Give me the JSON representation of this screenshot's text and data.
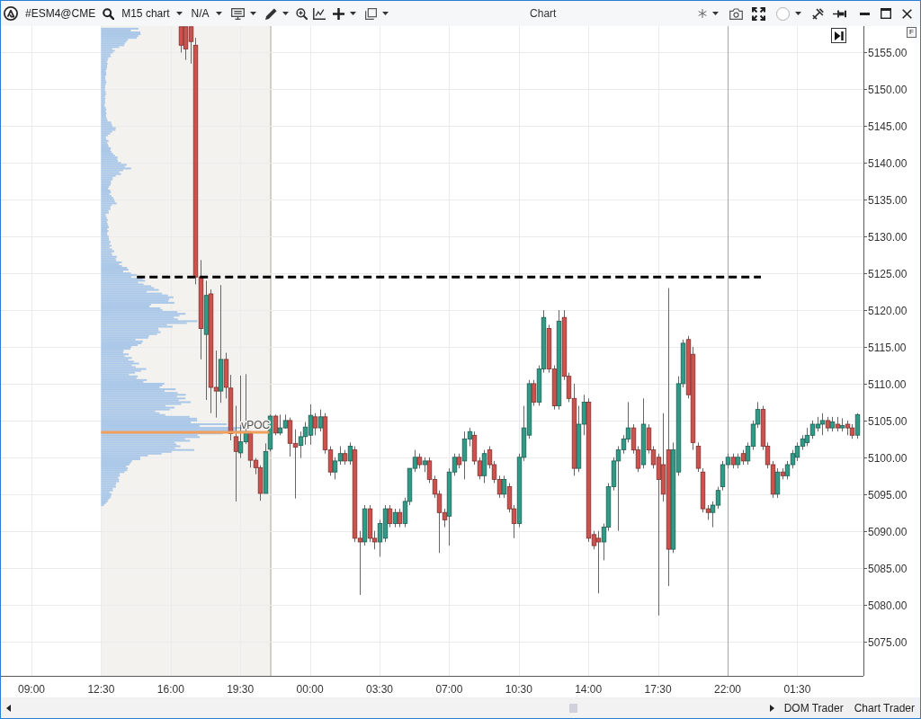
{
  "window": {
    "title": "Chart"
  },
  "toolbar": {
    "instrument": "#ESM4@CME",
    "timeframe": "M15 chart",
    "template": "N/A"
  },
  "chart": {
    "corner_badge": "F",
    "chart_data": {
      "type": "candlestick",
      "grid": true,
      "ylim": [
        5070.3,
        5158.6
      ],
      "yticks": [
        {
          "value": 5155,
          "label": "5155.00"
        },
        {
          "value": 5150,
          "label": "5150.00"
        },
        {
          "value": 5145,
          "label": "5145.00"
        },
        {
          "value": 5140,
          "label": "5140.00"
        },
        {
          "value": 5135,
          "label": "5135.00"
        },
        {
          "value": 5130,
          "label": "5130.00"
        },
        {
          "value": 5125,
          "label": "5125.00"
        },
        {
          "value": 5120,
          "label": "5120.00"
        },
        {
          "value": 5115,
          "label": "5115.00"
        },
        {
          "value": 5110,
          "label": "5110.00"
        },
        {
          "value": 5105,
          "label": "5105.00"
        },
        {
          "value": 5100,
          "label": "5100.00"
        },
        {
          "value": 5095,
          "label": "5095.00"
        },
        {
          "value": 5090,
          "label": "5090.00"
        },
        {
          "value": 5085,
          "label": "5085.00"
        },
        {
          "value": 5080,
          "label": "5080.00"
        },
        {
          "value": 5075,
          "label": "5075.00"
        }
      ],
      "categories": [
        "09:00",
        null,
        null,
        null,
        null,
        null,
        null,
        null,
        null,
        null,
        null,
        null,
        null,
        null,
        "12:30",
        null,
        null,
        null,
        null,
        null,
        null,
        null,
        null,
        null,
        null,
        null,
        null,
        null,
        "16:00",
        null,
        null,
        null,
        null,
        null,
        null,
        null,
        null,
        null,
        null,
        null,
        null,
        null,
        "19:30",
        null,
        null,
        null,
        null,
        null,
        null,
        null,
        null,
        null,
        null,
        null,
        null,
        null,
        "00:00",
        null,
        null,
        null,
        null,
        null,
        null,
        null,
        null,
        null,
        null,
        null,
        null,
        null,
        "03:30",
        null,
        null,
        null,
        null,
        null,
        null,
        null,
        null,
        null,
        null,
        null,
        null,
        null,
        "07:00",
        null,
        null,
        null,
        null,
        null,
        null,
        null,
        null,
        null,
        null,
        null,
        null,
        null,
        "10:30",
        null,
        null,
        null,
        null,
        null,
        null,
        null,
        null,
        null,
        null,
        null,
        null,
        null,
        "14:00",
        null,
        null,
        null,
        null,
        null,
        null,
        null,
        null,
        null,
        null,
        null,
        null,
        null,
        "17:30",
        null,
        null,
        null,
        null,
        null,
        null,
        null,
        null,
        null,
        null,
        null,
        null,
        null,
        "22:00",
        null,
        null,
        null,
        null,
        null,
        null,
        null,
        null,
        null,
        null,
        null,
        null,
        null,
        "01:30",
        null,
        null,
        null,
        null,
        null,
        null,
        null,
        null,
        null,
        null,
        null,
        null
      ],
      "ohlc": [
        null,
        null,
        null,
        null,
        null,
        null,
        null,
        null,
        null,
        null,
        null,
        null,
        null,
        null,
        null,
        null,
        null,
        null,
        null,
        null,
        null,
        null,
        null,
        null,
        null,
        null,
        null,
        null,
        null,
        null,
        [
          5158.5,
          5158.5,
          5155,
          5156
        ],
        [
          5158.5,
          5158.5,
          5154,
          5155.5
        ],
        [
          5158.5,
          5158.5,
          5153.5,
          5156.5
        ],
        [
          5156,
          5157,
          5123.5,
          5124.5
        ],
        [
          5124.5,
          5126.8,
          5113.3,
          5117.5
        ],
        [
          5116.7,
          5124,
          5107.8,
          5122
        ],
        [
          5122.2,
          5122.8,
          5106,
          5109.5
        ],
        [
          5109.5,
          5114.5,
          5105.4,
          5109
        ],
        [
          5109,
          5123.4,
          5107.4,
          5113.3
        ],
        [
          5113.3,
          5114.2,
          5108,
          5109.5
        ],
        [
          5109.4,
          5111.2,
          5102.3,
          5103.2
        ],
        [
          5102.8,
          5107,
          5094,
          5100.8
        ],
        [
          5100.6,
          5111.1,
          5099.9,
          5102.1
        ],
        [
          5102.1,
          5111.3,
          5101.8,
          5103.2
        ],
        [
          5103.2,
          5103.5,
          5098.6,
          5099.6
        ],
        [
          5099.6,
          5099.9,
          5097.7,
          5098.6
        ],
        [
          5098.6,
          5098.9,
          5094.1,
          5095.1
        ],
        [
          5095.1,
          5101.9,
          5095.1,
          5100.8
        ],
        [
          5101.1,
          5105.8,
          5100.8,
          5105.6
        ],
        [
          5105.6,
          5105.8,
          5103,
          5103.3
        ],
        [
          5103.3,
          5105.8,
          5103,
          5104
        ],
        [
          5104,
          5105.8,
          5103.9,
          5105
        ],
        [
          5105,
          5105.4,
          5100.1,
          5101.9
        ],
        [
          5101.9,
          5103.8,
          5094.4,
          5101.4
        ],
        [
          5101.6,
          5103.5,
          5099.9,
          5102.8
        ],
        [
          5102.8,
          5104.8,
          5101.7,
          5104.1
        ],
        [
          5103,
          5107.2,
          5101.7,
          5105.7
        ],
        [
          5105.5,
          5106,
          5103,
          5104
        ],
        [
          5104,
          5106.5,
          5103.5,
          5105.5
        ],
        [
          5105.5,
          5106,
          5100.5,
          5101
        ],
        [
          5101,
          5101.5,
          5097.5,
          5098
        ],
        [
          5098,
          5100,
          5097,
          5099.5
        ],
        [
          5099.5,
          5101.5,
          5099,
          5100.5
        ],
        [
          5100.5,
          5101,
          5099,
          5099.5
        ],
        [
          5099.5,
          5102,
          5099,
          5101.5
        ],
        [
          5101,
          5101.5,
          5088.5,
          5089
        ],
        [
          5089,
          5090,
          5081.3,
          5088.5
        ],
        [
          5088.5,
          5093.5,
          5088,
          5093
        ],
        [
          5093,
          5093.5,
          5088.5,
          5089
        ],
        [
          5089,
          5090,
          5087.5,
          5088.5
        ],
        [
          5088.5,
          5091.5,
          5086.5,
          5091
        ],
        [
          5089,
          5093.5,
          5088.5,
          5093
        ],
        [
          5093,
          5093.5,
          5090.5,
          5091
        ],
        [
          5091,
          5093,
          5090.5,
          5092.5
        ],
        [
          5092.5,
          5093,
          5090.5,
          5091
        ],
        [
          5091,
          5094.5,
          5090.5,
          5094
        ],
        [
          5094,
          5098.5,
          5093.5,
          5098.5
        ],
        [
          5098.5,
          5101,
          5098,
          5100
        ],
        [
          5100,
          5100.5,
          5098.5,
          5099
        ],
        [
          5099,
          5100,
          5098,
          5099.5
        ],
        [
          5099.5,
          5100,
          5096.5,
          5097
        ],
        [
          5097,
          5097.5,
          5094.5,
          5095
        ],
        [
          5095,
          5095.5,
          5087,
          5092.5
        ],
        [
          5092.5,
          5093,
          5090.5,
          5091.5
        ],
        [
          5092,
          5098.5,
          5088,
          5098
        ],
        [
          5098,
          5100.5,
          5097.5,
          5100
        ],
        [
          5100,
          5100.5,
          5098.5,
          5099
        ],
        [
          5099.5,
          5103.5,
          5097,
          5102.5
        ],
        [
          5102.5,
          5104,
          5101.5,
          5103.5
        ],
        [
          5103,
          5103.5,
          5099,
          5099.5
        ],
        [
          5099.5,
          5100,
          5097,
          5097.5
        ],
        [
          5097.5,
          5101,
          5096.5,
          5100.5
        ],
        [
          5101,
          5101.5,
          5098.5,
          5099
        ],
        [
          5099,
          5099.5,
          5096.5,
          5097
        ],
        [
          5097,
          5097.5,
          5094.5,
          5095
        ],
        [
          5095,
          5097.5,
          5094.5,
          5097
        ],
        [
          5096,
          5096.5,
          5092.5,
          5093
        ],
        [
          5093,
          5093.5,
          5089,
          5091
        ],
        [
          5091,
          5100.5,
          5090.5,
          5100
        ],
        [
          5100,
          5107,
          5099.5,
          5104
        ],
        [
          5103,
          5110.5,
          5102.5,
          5110
        ],
        [
          5110,
          5110.5,
          5107,
          5107.5
        ],
        [
          5107.5,
          5112.5,
          5107,
          5112
        ],
        [
          5112,
          5120,
          5111.5,
          5119
        ],
        [
          5117.5,
          5118,
          5111.5,
          5112
        ],
        [
          5112,
          5112.5,
          5106.5,
          5107
        ],
        [
          5107,
          5120,
          5106.5,
          5118.5
        ],
        [
          5119,
          5120,
          5110.5,
          5111
        ],
        [
          5111,
          5111.5,
          5107.5,
          5108
        ],
        [
          5108,
          5110,
          5097.5,
          5098.5
        ],
        [
          5098.5,
          5107,
          5098,
          5104.5
        ],
        [
          5104.5,
          5108.5,
          5103,
          5107.5
        ],
        [
          5107.5,
          5108,
          5088.5,
          5089
        ],
        [
          5089.5,
          5090,
          5087.5,
          5088
        ],
        [
          5089,
          5090,
          5081.5,
          5088.5
        ],
        [
          5088.5,
          5091,
          5086,
          5090.5
        ],
        [
          5090.5,
          5096.5,
          5090,
          5096
        ],
        [
          5096,
          5100,
          5095.5,
          5099.5
        ],
        [
          5099.5,
          5101.5,
          5090,
          5101
        ],
        [
          5101,
          5103,
          5100.5,
          5102.5
        ],
        [
          5102.5,
          5107.5,
          5102,
          5104
        ],
        [
          5104,
          5104.5,
          5100.5,
          5101
        ],
        [
          5101,
          5101.5,
          5098,
          5098.5
        ],
        [
          5099,
          5108,
          5098.5,
          5104.5
        ],
        [
          5104,
          5104.5,
          5100.5,
          5101
        ],
        [
          5101,
          5101.5,
          5098.5,
          5099
        ],
        [
          5100,
          5100.5,
          5078.5,
          5097
        ],
        [
          5099,
          5106,
          5094,
          5095
        ],
        [
          5101,
          5123,
          5082.5,
          5087.5
        ],
        [
          5087.5,
          5102,
          5087,
          5101
        ],
        [
          5098,
          5111,
          5097.5,
          5110
        ],
        [
          5110,
          5116,
          5109.5,
          5115.5
        ],
        [
          5116,
          5116.5,
          5108,
          5108.5
        ],
        [
          5114,
          5115,
          5101,
          5102
        ],
        [
          5101.5,
          5102,
          5098,
          5098.5
        ],
        [
          5098,
          5098.5,
          5092.5,
          5093
        ],
        [
          5093,
          5093.5,
          5091.5,
          5092.5
        ],
        [
          5092.5,
          5094,
          5090.5,
          5093.5
        ],
        [
          5093.5,
          5096,
          5093,
          5095.5
        ],
        [
          5096,
          5099.5,
          5095.5,
          5099
        ],
        [
          5099,
          5100.5,
          5098.5,
          5100
        ],
        [
          5100,
          5100.5,
          5098.5,
          5099
        ],
        [
          5099,
          5100.5,
          5098.5,
          5100
        ],
        [
          5100.5,
          5101,
          5099,
          5099.5
        ],
        [
          5099.5,
          5102,
          5099,
          5101.5
        ],
        [
          5101.5,
          5105,
          5101,
          5104.5
        ],
        [
          5104.5,
          5107.5,
          5104,
          5106.5
        ],
        [
          5106.5,
          5107,
          5101,
          5101.5
        ],
        [
          5101.5,
          5102,
          5098.5,
          5099
        ],
        [
          5099,
          5099.5,
          5094.5,
          5095
        ],
        [
          5095,
          5098.5,
          5094.5,
          5098
        ],
        [
          5098,
          5098.5,
          5097,
          5097.5
        ],
        [
          5097.5,
          5099.5,
          5097,
          5099
        ],
        [
          5099,
          5101,
          5098.5,
          5100.5
        ],
        [
          5100,
          5102,
          5099.5,
          5101.5
        ],
        [
          5101.5,
          5103,
          5101,
          5102.5
        ],
        [
          5102,
          5104,
          5101.5,
          5103
        ],
        [
          5103,
          5105,
          5102.5,
          5104.5
        ],
        [
          5104,
          5105.5,
          5103.5,
          5104.5
        ],
        [
          5104.5,
          5106,
          5103,
          5105
        ],
        [
          5105,
          5105.5,
          5103.5,
          5104
        ],
        [
          5104,
          5105.5,
          5103.5,
          5104.8
        ],
        [
          5104.5,
          5105.5,
          5103.5,
          5104
        ],
        [
          5104,
          5105.3,
          5103.5,
          5104.3
        ],
        [
          5104.5,
          5105,
          5103,
          5104
        ],
        [
          5104,
          5104.5,
          5102.5,
          5103
        ],
        [
          5103,
          5106,
          5102.5,
          5105.8
        ]
      ],
      "ref_lines": [
        {
          "axis": "y",
          "value": 5103.4,
          "color": "#f0a05c",
          "label": "vPOC"
        },
        {
          "axis": "y",
          "value": 5124.5,
          "color": "#000000"
        }
      ]
    }
  },
  "footer": {
    "buttons": [
      "DOM Trader",
      "Chart Trader"
    ]
  }
}
